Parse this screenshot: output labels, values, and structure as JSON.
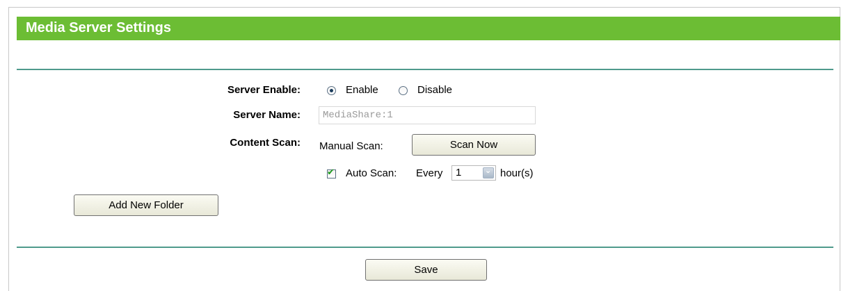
{
  "header": {
    "title": "Media Server Settings"
  },
  "server_enable": {
    "label": "Server Enable:",
    "options": [
      {
        "label": "Enable",
        "selected": true
      },
      {
        "label": "Disable",
        "selected": false
      }
    ]
  },
  "server_name": {
    "label": "Server Name:",
    "value": "MediaShare:1"
  },
  "content_scan": {
    "label": "Content Scan:",
    "manual_label": "Manual Scan:",
    "scan_now_label": "Scan Now",
    "auto_scan": {
      "checked": true,
      "label": "Auto Scan:",
      "every_label": "Every",
      "interval_value": "1",
      "unit_label": "hour(s)"
    }
  },
  "buttons": {
    "add_folder_label": "Add New Folder",
    "save_label": "Save"
  },
  "colors": {
    "title_bar": "#6cbd34",
    "rule": "#4f9a8c",
    "check": "#1c9a1c"
  }
}
